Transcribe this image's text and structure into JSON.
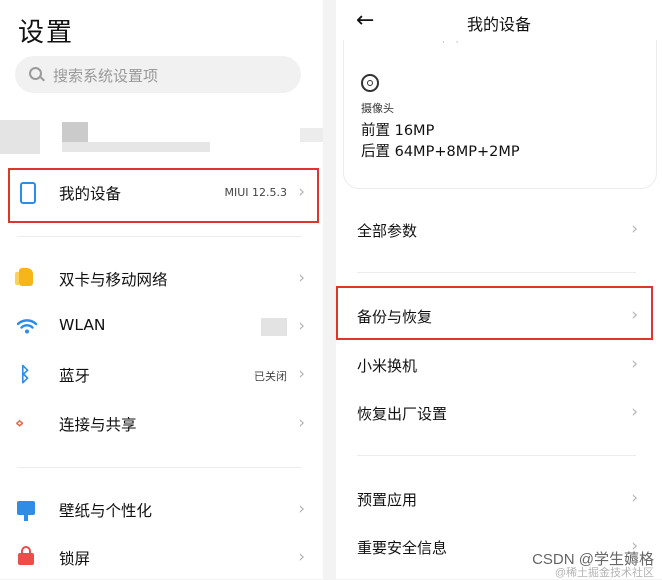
{
  "left": {
    "title": "设置",
    "search": {
      "placeholder": "搜索系统设置项"
    },
    "items": [
      {
        "label": "我的设备",
        "value": "MIUI 12.5.3",
        "icon": "phone-device-icon"
      },
      {
        "label": "双卡与移动网络",
        "value": "",
        "icon": "sim-card-icon"
      },
      {
        "label": "WLAN",
        "value": "",
        "icon": "wifi-icon"
      },
      {
        "label": "蓝牙",
        "value": "已关闭",
        "icon": "bluetooth-icon"
      },
      {
        "label": "连接与共享",
        "value": "",
        "icon": "share-connection-icon"
      },
      {
        "label": "壁纸与个性化",
        "value": "",
        "icon": "wallpaper-icon"
      },
      {
        "label": "锁屏",
        "value": "",
        "icon": "lock-icon"
      }
    ]
  },
  "right": {
    "title": "我的设备",
    "camera": {
      "label": "摄像头",
      "front": "前置 16MP",
      "rear": "后置 64MP+8MP+2MP"
    },
    "items": [
      {
        "label": "全部参数"
      },
      {
        "label": "备份与恢复"
      },
      {
        "label": "小米换机"
      },
      {
        "label": "恢复出厂设置"
      },
      {
        "label": "预置应用"
      },
      {
        "label": "重要安全信息"
      }
    ]
  },
  "watermark": {
    "line1": "CSDN @学生薅格",
    "line2": "@稀土掘金技术社区"
  },
  "colors": {
    "highlight": "#e0342e",
    "accent": "#2a8de8"
  }
}
